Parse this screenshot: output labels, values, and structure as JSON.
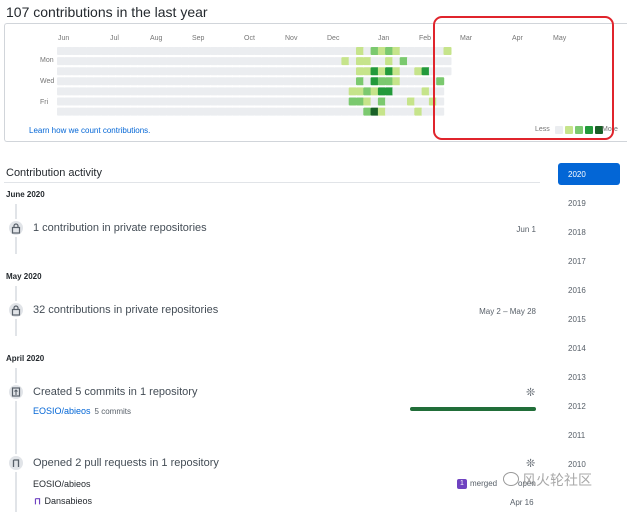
{
  "header": {
    "title": "107 contributions in the last year"
  },
  "graph": {
    "months": [
      "Jun",
      "Jul",
      "Aug",
      "Sep",
      "Oct",
      "Nov",
      "Dec",
      "Jan",
      "Feb",
      "Mar",
      "Apr",
      "May"
    ],
    "days": [
      "Mon",
      "Wed",
      "Fri"
    ],
    "learn_link": "Learn how we count contributions.",
    "legend_less": "Less",
    "legend_more": "More",
    "colors": {
      "empty": "#ebedf0",
      "l1": "#c6e48b",
      "l2": "#7bc96f",
      "l3": "#239a3b",
      "l4": "#196127"
    },
    "active_weeks": [
      {
        "week": 43,
        "levels": [
          0,
          0,
          0,
          0,
          0,
          0,
          0
        ]
      },
      {
        "week": 44,
        "levels": [
          0,
          0,
          0,
          0,
          0,
          0,
          0
        ]
      },
      {
        "week": 45,
        "levels": [
          0,
          0,
          0,
          0,
          0,
          0,
          0
        ]
      },
      {
        "week": 46,
        "levels": [
          0,
          1,
          0,
          0,
          0,
          0,
          0
        ]
      },
      {
        "week": 47,
        "levels": [
          0,
          0,
          0,
          0,
          1,
          2,
          0
        ]
      },
      {
        "week": 48,
        "levels": [
          1,
          1,
          1,
          2,
          1,
          2,
          0
        ]
      },
      {
        "week": 49,
        "levels": [
          0,
          1,
          1,
          0,
          2,
          1,
          2
        ]
      },
      {
        "week": 50,
        "levels": [
          2,
          0,
          3,
          3,
          1,
          0,
          4
        ]
      },
      {
        "week": 51,
        "levels": [
          1,
          0,
          1,
          2,
          3,
          2,
          1
        ]
      },
      {
        "week": 52,
        "levels": [
          2,
          1,
          3,
          2,
          3,
          0,
          0
        ]
      },
      {
        "week": 53,
        "levels": [
          1,
          0,
          1,
          1,
          0,
          0,
          0
        ]
      },
      {
        "week": 54,
        "levels": [
          0,
          2,
          0,
          0,
          0,
          0,
          0
        ]
      },
      {
        "week": 55,
        "levels": [
          0,
          0,
          0,
          0,
          0,
          1,
          0
        ]
      },
      {
        "week": 56,
        "levels": [
          0,
          0,
          1,
          0,
          0,
          0,
          1
        ]
      },
      {
        "week": 57,
        "levels": [
          0,
          0,
          3,
          0,
          1,
          0,
          0
        ]
      },
      {
        "week": 58,
        "levels": [
          0,
          0,
          0,
          0,
          0,
          1,
          0
        ]
      },
      {
        "week": 59,
        "levels": [
          0,
          0,
          0,
          2,
          0,
          0,
          0
        ]
      },
      {
        "week": 60,
        "levels": [
          1,
          0,
          0,
          0,
          0,
          0,
          0
        ]
      }
    ]
  },
  "activity": {
    "title": "Contribution activity",
    "sections": [
      {
        "month": "June 2020",
        "events": [
          {
            "text": "1 contribution in private repositories",
            "date": "Jun 1"
          }
        ]
      },
      {
        "month": "May 2020",
        "events": [
          {
            "text": "32 contributions in private repositories",
            "date": "May 2 – May 28"
          }
        ]
      },
      {
        "month": "April 2020",
        "events": [
          {
            "text": "Created 5 commits in 1 repository",
            "repo": "EOSIO/abieos",
            "count": "5 commits"
          },
          {
            "text": "Opened 2 pull requests in 1 repository",
            "repo": "EOSIO/abieos",
            "merged": "merged",
            "open": "open",
            "author": "Dansabieos",
            "date": "Apr 16"
          }
        ]
      }
    ]
  },
  "years": [
    "2020",
    "2019",
    "2018",
    "2017",
    "2016",
    "2015",
    "2014",
    "2013",
    "2012",
    "2011",
    "2010"
  ],
  "watermark": "风火轮社区"
}
